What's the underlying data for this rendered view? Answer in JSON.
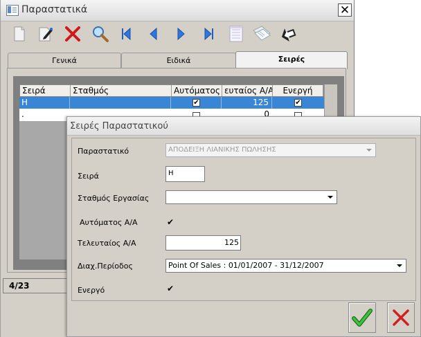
{
  "window": {
    "title": "Παραστατικά",
    "close_glyph": "✕"
  },
  "toolbar": {
    "buttons": [
      {
        "name": "new-document-icon"
      },
      {
        "name": "edit-pencil-icon"
      },
      {
        "name": "delete-x-icon"
      },
      {
        "name": "search-magnifier-icon"
      },
      {
        "name": "first-record-icon"
      },
      {
        "name": "previous-record-icon"
      },
      {
        "name": "next-record-icon"
      },
      {
        "name": "last-record-icon"
      },
      {
        "name": "form-sheet-icon"
      },
      {
        "name": "copy-documents-icon"
      },
      {
        "name": "back-arrow-icon"
      }
    ]
  },
  "tabs": [
    {
      "label": "Γενικά"
    },
    {
      "label": "Ειδικά"
    },
    {
      "label": "Σειρές",
      "active": true
    }
  ],
  "grid": {
    "headers": [
      "Σειρά",
      "Σταθμός",
      "Αυτόματος",
      "ευταίος Α/Α",
      "Ενεργή"
    ],
    "rows": [
      {
        "seira": "H",
        "stathmos": "",
        "automatos": true,
        "last": "125",
        "energi": true
      },
      {
        "seira": ".",
        "stathmos": "",
        "automatos": false,
        "last": "0",
        "energi": true
      }
    ]
  },
  "status": {
    "record": "4/23"
  },
  "dialog": {
    "title": "Σειρές Παραστατικού",
    "fields": {
      "document_label": "Παραστατικό",
      "document_value": "ΑΠΟΔΕΙΞΗ ΛΙΑΝΙΚΗΣ ΠΩΛΗΣΗΣ",
      "series_label": "Σειρά",
      "series_value": "H",
      "station_label": "Σταθμός Εργασίας",
      "station_value": "",
      "auto_label": "Αυτόματος Α/Α",
      "auto_checked": true,
      "last_label": "Τελευταίος Α/Α",
      "last_value": "125",
      "period_label": "Διαχ.Περίοδος",
      "period_value": "Point Of Sales : 01/01/2007 - 31/12/2007",
      "active_label": "Ενεργό",
      "active_checked": true
    },
    "ok_icon": "green-checkmark-icon",
    "cancel_icon": "red-x-icon"
  },
  "colors": {
    "selection": "#3a86d6",
    "ok_green": "#2e9e2e",
    "cancel_red": "#cc2222"
  }
}
